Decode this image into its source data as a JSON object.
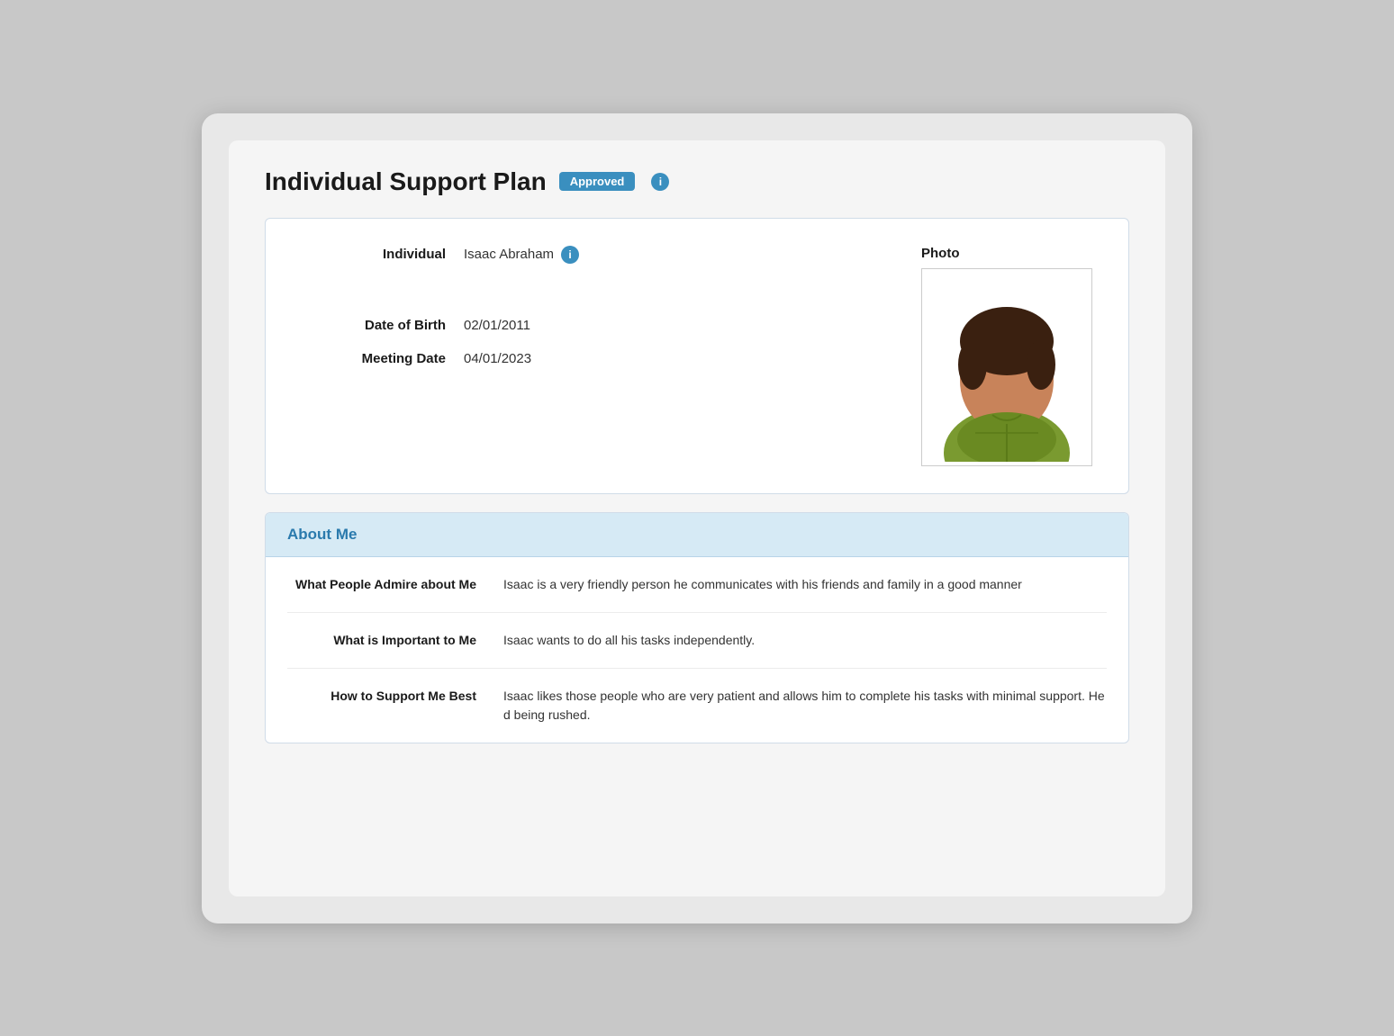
{
  "page": {
    "title": "Individual Support Plan",
    "status": "Approved",
    "info_icon_label": "i"
  },
  "individual": {
    "label": "Individual",
    "name": "Isaac Abraham",
    "photo_label": "Photo"
  },
  "fields": {
    "date_of_birth_label": "Date of Birth",
    "date_of_birth_value": "02/01/2011",
    "meeting_date_label": "Meeting Date",
    "meeting_date_value": "04/01/2023"
  },
  "about_me": {
    "section_title": "About Me",
    "rows": [
      {
        "label": "What People Admire about Me",
        "value": "Isaac is a very friendly person he communicates with his friends and family in a good manner"
      },
      {
        "label": "What is Important to Me",
        "value": "Isaac wants to do all his tasks independently."
      },
      {
        "label": "How to Support Me Best",
        "value": "Isaac likes those people who are very patient and allows him to complete his tasks with minimal support. He d being rushed."
      }
    ]
  },
  "colors": {
    "accent": "#3a8fbf",
    "badge_bg": "#3a8fbf",
    "about_me_header_bg": "#d6eaf5",
    "about_me_title": "#2a7aad"
  }
}
